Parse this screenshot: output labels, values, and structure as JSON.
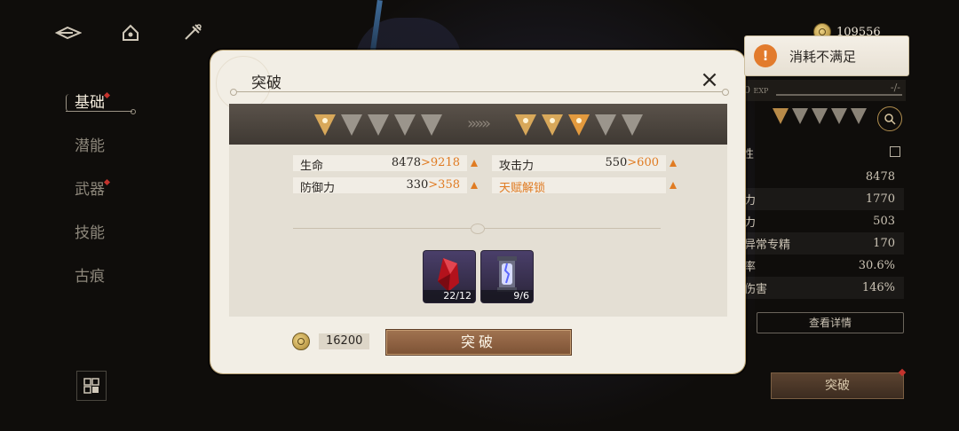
{
  "top_nav": {
    "icons": [
      "back-icon",
      "home-icon",
      "tools-icon"
    ]
  },
  "sidebar": {
    "items": [
      {
        "label": "基础",
        "active": true,
        "dot": true
      },
      {
        "label": "潜能",
        "active": false,
        "dot": false
      },
      {
        "label": "武器",
        "active": false,
        "dot": true
      },
      {
        "label": "技能",
        "active": false,
        "dot": false
      },
      {
        "label": "古痕",
        "active": false,
        "dot": false
      }
    ]
  },
  "right_panel": {
    "currency": "109556",
    "exp": {
      "level": "0",
      "unit": "EXP",
      "ratio": "-/-"
    },
    "attributes": [
      {
        "name": "",
        "value": "8478"
      },
      {
        "name": "力",
        "value": "1770"
      },
      {
        "name": "力",
        "value": "503"
      },
      {
        "name": "异常专精",
        "value": "170"
      },
      {
        "name": "率",
        "value": "30.6%"
      },
      {
        "name": "伤害",
        "value": "146%"
      }
    ],
    "section_label": "性",
    "detail_button": "查看详情",
    "breakthrough_button": "突破"
  },
  "toast": {
    "icon_text": "!",
    "message": "消耗不满足"
  },
  "dialog": {
    "title": "突破",
    "close_icon": "×",
    "stars_before": {
      "filled": 1,
      "total": 5
    },
    "stars_after": {
      "filled": 3,
      "total": 5
    },
    "arrow_glyph": "»»»",
    "stats": [
      {
        "name": "生命",
        "old": "8478",
        "sep": ">",
        "new": "9218"
      },
      {
        "name": "攻击力",
        "old": "550",
        "sep": ">",
        "new": "600"
      },
      {
        "name": "防御力",
        "old": "330",
        "sep": ">",
        "new": "358"
      },
      {
        "name": "天赋解锁",
        "old": "",
        "sep": "",
        "new": ""
      }
    ],
    "materials": [
      {
        "name": "red-crystal",
        "count": "22/12"
      },
      {
        "name": "light-canister",
        "count": "9/6"
      }
    ],
    "cost": "16200",
    "confirm_button": "突破"
  },
  "colors": {
    "accent_orange": "#e07b22",
    "dialog_bg": "#f2eee5",
    "button_brown": "#8c5f3f",
    "alert_red": "#c4332d"
  }
}
